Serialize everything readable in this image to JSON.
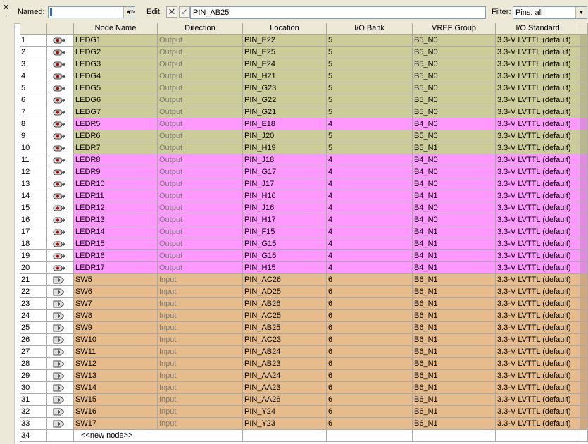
{
  "toolbar": {
    "close_glyph": "×",
    "collapse_glyph": "▸",
    "named_label": "Named:",
    "named_dropdown_glyph": "▼",
    "nav_glyph": "«»",
    "edit_label": "Edit:",
    "cancel_glyph": "✕",
    "accept_glyph": "✓",
    "edit_value": "PIN_AB25",
    "filter_label": "Filter:",
    "filter_value": "Pins: all",
    "filter_dropdown_glyph": "▼"
  },
  "icons": {
    "output": "output-pin-icon",
    "input": "input-pin-icon"
  },
  "colors": {
    "ledg_row": "#cccc99",
    "ledr_row": "#ff99ff",
    "sw_row": "#e6bc8c"
  },
  "columns": [
    "Node Name",
    "Direction",
    "Location",
    "I/O Bank",
    "VREF Group",
    "I/O Standard"
  ],
  "rows": [
    {
      "num": "1",
      "group": "LEDG",
      "icon": "output",
      "name": "LEDG1",
      "dir": "Output",
      "loc": "PIN_E22",
      "bank": "5",
      "vref": "B5_N0",
      "std": "3.3-V LVTTL (default)"
    },
    {
      "num": "2",
      "group": "LEDG",
      "icon": "output",
      "name": "LEDG2",
      "dir": "Output",
      "loc": "PIN_E25",
      "bank": "5",
      "vref": "B5_N0",
      "std": "3.3-V LVTTL (default)"
    },
    {
      "num": "3",
      "group": "LEDG",
      "icon": "output",
      "name": "LEDG3",
      "dir": "Output",
      "loc": "PIN_E24",
      "bank": "5",
      "vref": "B5_N0",
      "std": "3.3-V LVTTL (default)"
    },
    {
      "num": "4",
      "group": "LEDG",
      "icon": "output",
      "name": "LEDG4",
      "dir": "Output",
      "loc": "PIN_H21",
      "bank": "5",
      "vref": "B5_N0",
      "std": "3.3-V LVTTL (default)"
    },
    {
      "num": "5",
      "group": "LEDG",
      "icon": "output",
      "name": "LEDG5",
      "dir": "Output",
      "loc": "PIN_G23",
      "bank": "5",
      "vref": "B5_N0",
      "std": "3.3-V LVTTL (default)"
    },
    {
      "num": "6",
      "group": "LEDG",
      "icon": "output",
      "name": "LEDG6",
      "dir": "Output",
      "loc": "PIN_G22",
      "bank": "5",
      "vref": "B5_N0",
      "std": "3.3-V LVTTL (default)"
    },
    {
      "num": "7",
      "group": "LEDG",
      "icon": "output",
      "name": "LEDG7",
      "dir": "Output",
      "loc": "PIN_G21",
      "bank": "5",
      "vref": "B5_N0",
      "std": "3.3-V LVTTL (default)"
    },
    {
      "num": "8",
      "group": "LEDR",
      "icon": "output",
      "name": "LEDR5",
      "dir": "Output",
      "loc": "PIN_E18",
      "bank": "4",
      "vref": "B4_N0",
      "std": "3.3-V LVTTL (default)"
    },
    {
      "num": "9",
      "group": "LEDG",
      "icon": "output",
      "name": "LEDR6",
      "dir": "Output",
      "loc": "PIN_J20",
      "bank": "5",
      "vref": "B5_N0",
      "std": "3.3-V LVTTL (default)"
    },
    {
      "num": "10",
      "group": "LEDG",
      "icon": "output",
      "name": "LEDR7",
      "dir": "Output",
      "loc": "PIN_H19",
      "bank": "5",
      "vref": "B5_N1",
      "std": "3.3-V LVTTL (default)"
    },
    {
      "num": "11",
      "group": "LEDR",
      "icon": "output",
      "name": "LEDR8",
      "dir": "Output",
      "loc": "PIN_J18",
      "bank": "4",
      "vref": "B4_N0",
      "std": "3.3-V LVTTL (default)"
    },
    {
      "num": "12",
      "group": "LEDR",
      "icon": "output",
      "name": "LEDR9",
      "dir": "Output",
      "loc": "PIN_G17",
      "bank": "4",
      "vref": "B4_N0",
      "std": "3.3-V LVTTL (default)"
    },
    {
      "num": "13",
      "group": "LEDR",
      "icon": "output",
      "name": "LEDR10",
      "dir": "Output",
      "loc": "PIN_J17",
      "bank": "4",
      "vref": "B4_N0",
      "std": "3.3-V LVTTL (default)"
    },
    {
      "num": "14",
      "group": "LEDR",
      "icon": "output",
      "name": "LEDR11",
      "dir": "Output",
      "loc": "PIN_H16",
      "bank": "4",
      "vref": "B4_N1",
      "std": "3.3-V LVTTL (default)"
    },
    {
      "num": "15",
      "group": "LEDR",
      "icon": "output",
      "name": "LEDR12",
      "dir": "Output",
      "loc": "PIN_J16",
      "bank": "4",
      "vref": "B4_N0",
      "std": "3.3-V LVTTL (default)"
    },
    {
      "num": "16",
      "group": "LEDR",
      "icon": "output",
      "name": "LEDR13",
      "dir": "Output",
      "loc": "PIN_H17",
      "bank": "4",
      "vref": "B4_N0",
      "std": "3.3-V LVTTL (default)"
    },
    {
      "num": "17",
      "group": "LEDR",
      "icon": "output",
      "name": "LEDR14",
      "dir": "Output",
      "loc": "PIN_F15",
      "bank": "4",
      "vref": "B4_N1",
      "std": "3.3-V LVTTL (default)"
    },
    {
      "num": "18",
      "group": "LEDR",
      "icon": "output",
      "name": "LEDR15",
      "dir": "Output",
      "loc": "PIN_G15",
      "bank": "4",
      "vref": "B4_N1",
      "std": "3.3-V LVTTL (default)"
    },
    {
      "num": "19",
      "group": "LEDR",
      "icon": "output",
      "name": "LEDR16",
      "dir": "Output",
      "loc": "PIN_G16",
      "bank": "4",
      "vref": "B4_N1",
      "std": "3.3-V LVTTL (default)"
    },
    {
      "num": "20",
      "group": "LEDR",
      "icon": "output",
      "name": "LEDR17",
      "dir": "Output",
      "loc": "PIN_H15",
      "bank": "4",
      "vref": "B4_N1",
      "std": "3.3-V LVTTL (default)"
    },
    {
      "num": "21",
      "group": "SW",
      "icon": "input",
      "name": "SW5",
      "dir": "Input",
      "loc": "PIN_AC26",
      "bank": "6",
      "vref": "B6_N1",
      "std": "3.3-V LVTTL (default)"
    },
    {
      "num": "22",
      "group": "SW",
      "icon": "input",
      "name": "SW6",
      "dir": "Input",
      "loc": "PIN_AD25",
      "bank": "6",
      "vref": "B6_N1",
      "std": "3.3-V LVTTL (default)"
    },
    {
      "num": "23",
      "group": "SW",
      "icon": "input",
      "name": "SW7",
      "dir": "Input",
      "loc": "PIN_AB26",
      "bank": "6",
      "vref": "B6_N1",
      "std": "3.3-V LVTTL (default)"
    },
    {
      "num": "24",
      "group": "SW",
      "icon": "input",
      "name": "SW8",
      "dir": "Input",
      "loc": "PIN_AC25",
      "bank": "6",
      "vref": "B6_N1",
      "std": "3.3-V LVTTL (default)"
    },
    {
      "num": "25",
      "group": "SW",
      "icon": "input",
      "name": "SW9",
      "dir": "Input",
      "loc": "PIN_AB25",
      "bank": "6",
      "vref": "B6_N1",
      "std": "3.3-V LVTTL (default)"
    },
    {
      "num": "26",
      "group": "SW",
      "icon": "input",
      "name": "SW10",
      "dir": "Input",
      "loc": "PIN_AC23",
      "bank": "6",
      "vref": "B6_N1",
      "std": "3.3-V LVTTL (default)"
    },
    {
      "num": "27",
      "group": "SW",
      "icon": "input",
      "name": "SW11",
      "dir": "Input",
      "loc": "PIN_AB24",
      "bank": "6",
      "vref": "B6_N1",
      "std": "3.3-V LVTTL (default)"
    },
    {
      "num": "28",
      "group": "SW",
      "icon": "input",
      "name": "SW12",
      "dir": "Input",
      "loc": "PIN_AB23",
      "bank": "6",
      "vref": "B6_N1",
      "std": "3.3-V LVTTL (default)"
    },
    {
      "num": "29",
      "group": "SW",
      "icon": "input",
      "name": "SW13",
      "dir": "Input",
      "loc": "PIN_AA24",
      "bank": "6",
      "vref": "B6_N1",
      "std": "3.3-V LVTTL (default)"
    },
    {
      "num": "30",
      "group": "SW",
      "icon": "input",
      "name": "SW14",
      "dir": "Input",
      "loc": "PIN_AA23",
      "bank": "6",
      "vref": "B6_N1",
      "std": "3.3-V LVTTL (default)"
    },
    {
      "num": "31",
      "group": "SW",
      "icon": "input",
      "name": "SW15",
      "dir": "Input",
      "loc": "PIN_AA26",
      "bank": "6",
      "vref": "B6_N1",
      "std": "3.3-V LVTTL (default)"
    },
    {
      "num": "32",
      "group": "SW",
      "icon": "input",
      "name": "SW16",
      "dir": "Input",
      "loc": "PIN_Y24",
      "bank": "6",
      "vref": "B6_N1",
      "std": "3.3-V LVTTL (default)"
    },
    {
      "num": "33",
      "group": "SW",
      "icon": "input",
      "name": "SW17",
      "dir": "Input",
      "loc": "PIN_Y23",
      "bank": "6",
      "vref": "B6_N1",
      "std": "3.3-V LVTTL (default)"
    }
  ],
  "new_row": {
    "num": "34",
    "label": "<<new node>>"
  }
}
